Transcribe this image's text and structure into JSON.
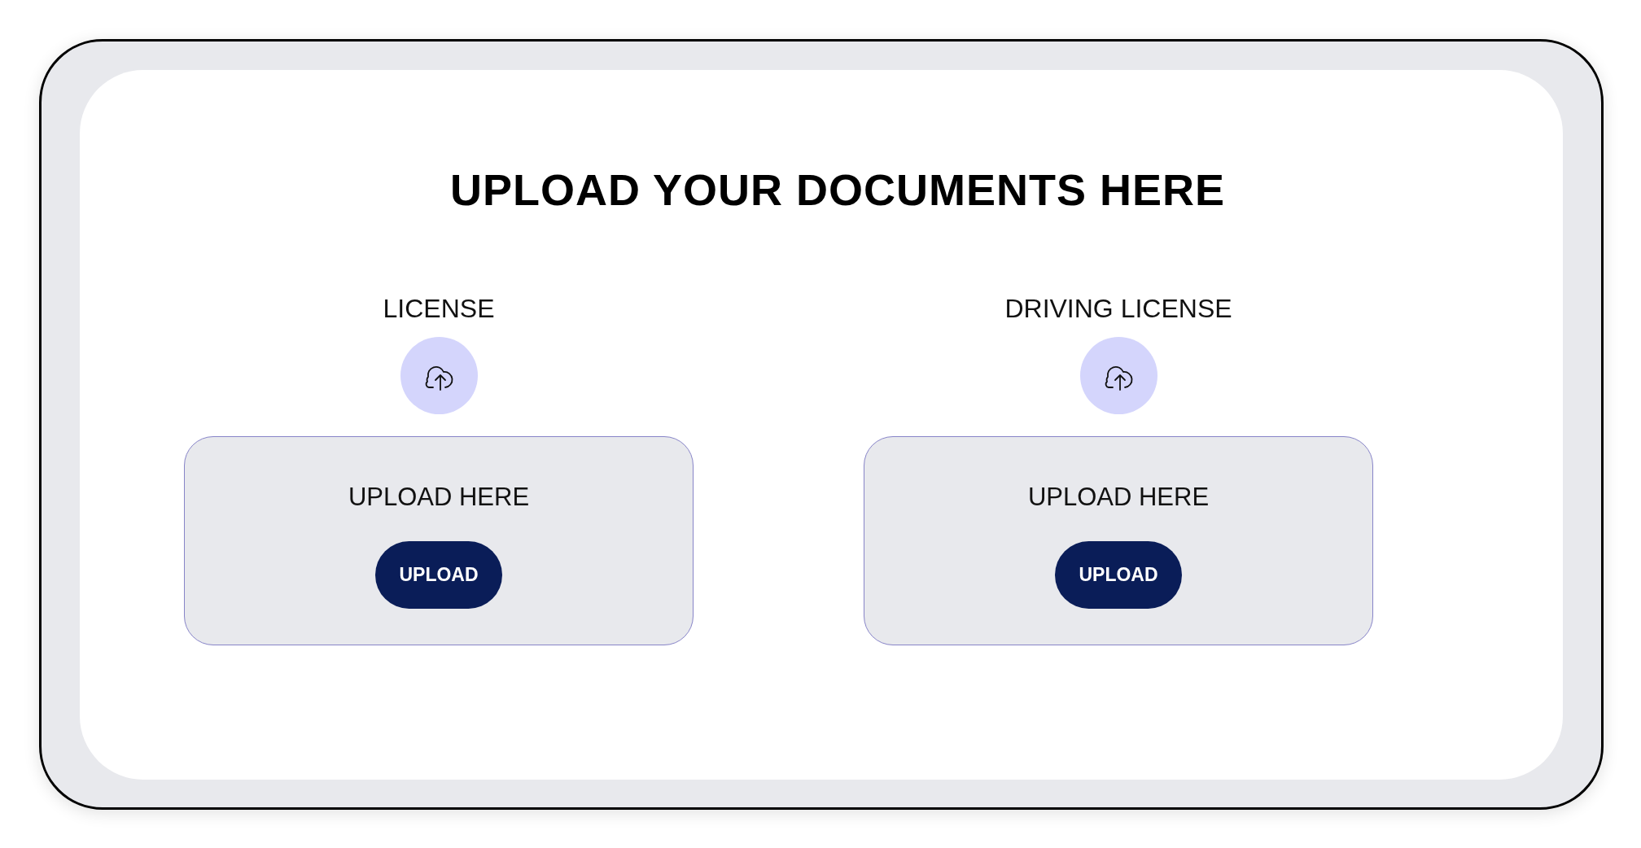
{
  "title": "UPLOAD YOUR DOCUMENTS HERE",
  "sections": [
    {
      "label": "LICENSE",
      "drop_text": "UPLOAD HERE",
      "button": "UPLOAD"
    },
    {
      "label": "DRIVING LICENSE",
      "drop_text": "UPLOAD HERE",
      "button": "UPLOAD"
    }
  ]
}
